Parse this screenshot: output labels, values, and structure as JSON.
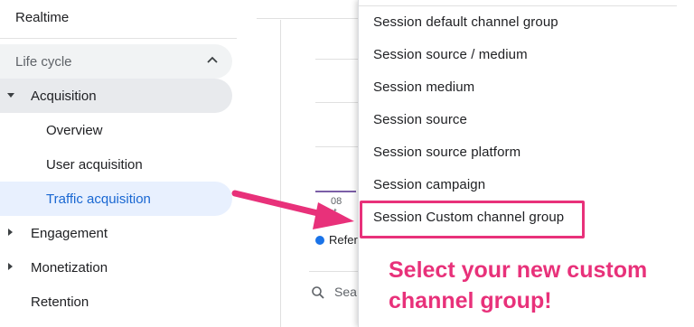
{
  "sidebar": {
    "realtime": "Realtime",
    "lifecycle": "Life cycle",
    "acquisition": "Acquisition",
    "overview": "Overview",
    "user_acquisition": "User acquisition",
    "traffic_acquisition": "Traffic acquisition",
    "engagement": "Engagement",
    "monetization": "Monetization",
    "retention": "Retention"
  },
  "content": {
    "tick_day": "08",
    "tick_month": "ct",
    "legend_label": "Refer",
    "search_text": "Sea"
  },
  "menu": {
    "items": [
      "Session default channel group",
      "Session source / medium",
      "Session medium",
      "Session source",
      "Session source platform",
      "Session campaign",
      "Session Custom channel group"
    ]
  },
  "annotation": {
    "line1": "Select your new custom",
    "line2": "channel group!"
  },
  "colors": {
    "accent_pink": "#e8317a",
    "selected_bg": "#e8f0fe",
    "selected_text": "#1967d2",
    "legend_blue": "#1a73e8"
  },
  "icons": [
    "chevron-up-icon",
    "caret-down-icon",
    "caret-right-icon",
    "search-icon",
    "arrow-icon"
  ]
}
